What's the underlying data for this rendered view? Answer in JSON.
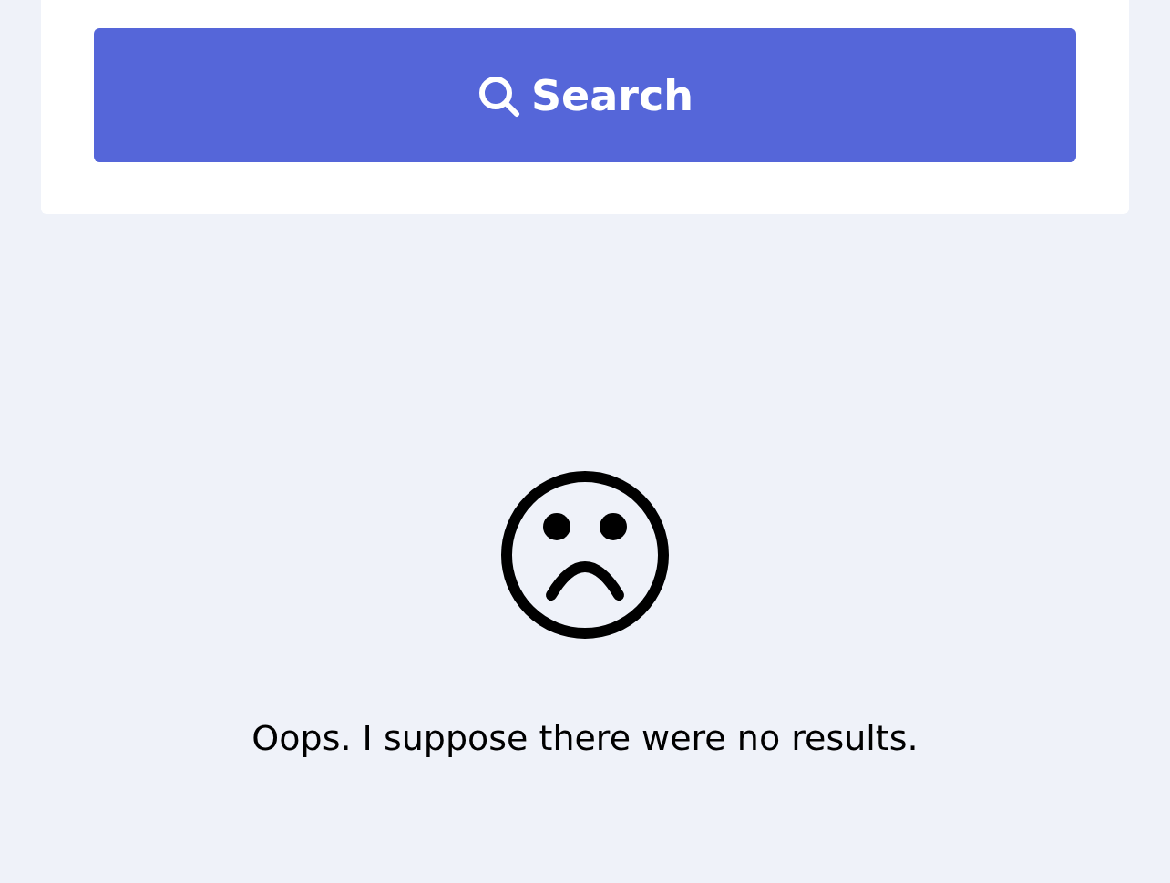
{
  "search_panel": {
    "button_label": "Search"
  },
  "empty_state": {
    "message": "Oops. I suppose there were no results."
  }
}
